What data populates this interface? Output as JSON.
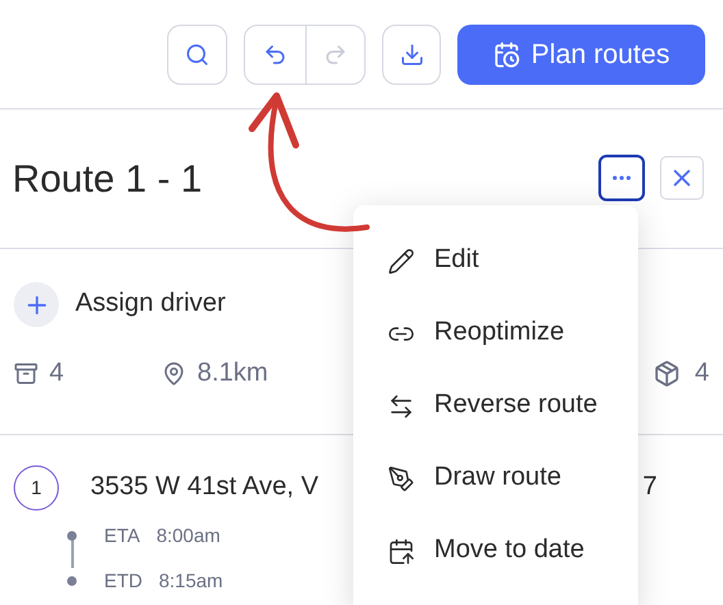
{
  "toolbar": {
    "plan_button": "Plan routes",
    "redo_disabled": true
  },
  "route": {
    "title": "Route 1 - 1",
    "menu_open": true,
    "assign_label": "Assign driver",
    "stops_count": "4",
    "distance": "8.1km",
    "packages_count": "4"
  },
  "stops": [
    {
      "number": "1",
      "address": "3535 W 41st Ave, V",
      "column_2": "7",
      "times": [
        {
          "label": "ETA",
          "value": "8:00am"
        },
        {
          "label": "ETD",
          "value": "8:15am"
        }
      ]
    }
  ],
  "menu": [
    {
      "kind": "edit",
      "label": "Edit"
    },
    {
      "kind": "reoptimize",
      "label": "Reoptimize"
    },
    {
      "kind": "reverse",
      "label": "Reverse route"
    },
    {
      "kind": "draw",
      "label": "Draw route"
    },
    {
      "kind": "move",
      "label": "Move to date"
    }
  ]
}
